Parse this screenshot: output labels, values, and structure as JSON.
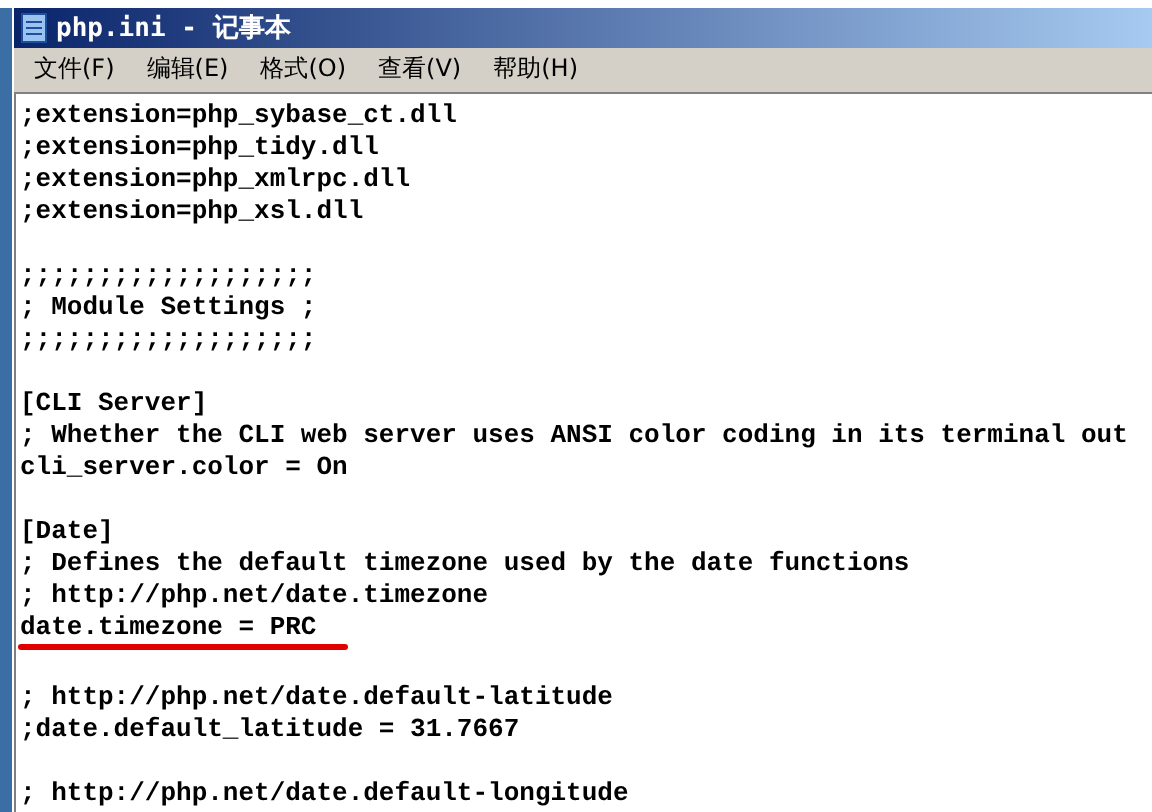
{
  "window": {
    "title": "php.ini - 记事本"
  },
  "menu": [
    "文件(F)",
    "编辑(E)",
    "格式(O)",
    "查看(V)",
    "帮助(H)"
  ],
  "blocks": [
    {
      "lines": [
        {
          "text": ";extension=php_sybase_ct.dll",
          "kind": "plain"
        },
        {
          "text": ";extension=php_tidy.dll",
          "kind": "plain"
        },
        {
          "text": ";extension=php_xmlrpc.dll",
          "kind": "plain"
        },
        {
          "text": ";extension=php_xsl.dll",
          "kind": "plain"
        }
      ]
    },
    {
      "lines": [
        {
          "text": ";;;;;;;;;;;;;;;;;;;",
          "kind": "plain"
        },
        {
          "text": "; Module Settings ;",
          "kind": "plain"
        },
        {
          "text": ";;;;;;;;;;;;;;;;;;;",
          "kind": "plain"
        }
      ]
    },
    {
      "lines": [
        {
          "text": "[CLI Server]",
          "kind": "plain"
        },
        {
          "text": "; Whether the CLI web server uses ANSI color coding in its terminal out",
          "kind": "plain"
        },
        {
          "text": "cli_server.color = On",
          "kind": "plain"
        }
      ]
    },
    {
      "lines": [
        {
          "text": "[Date]",
          "kind": "plain"
        },
        {
          "text": "; Defines the default timezone used by the date functions",
          "kind": "plain"
        },
        {
          "text": "; http://php.net/date.timezone",
          "kind": "plain"
        },
        {
          "text": "date.timezone = PRC",
          "kind": "underlined"
        }
      ]
    },
    {
      "lines": [
        {
          "text": "; http://php.net/date.default-latitude",
          "kind": "plain"
        },
        {
          "text": ";date.default_latitude = 31.7667",
          "kind": "plain"
        }
      ]
    },
    {
      "lines": [
        {
          "text": "; http://php.net/date.default-longitude",
          "kind": "plain"
        }
      ]
    }
  ]
}
